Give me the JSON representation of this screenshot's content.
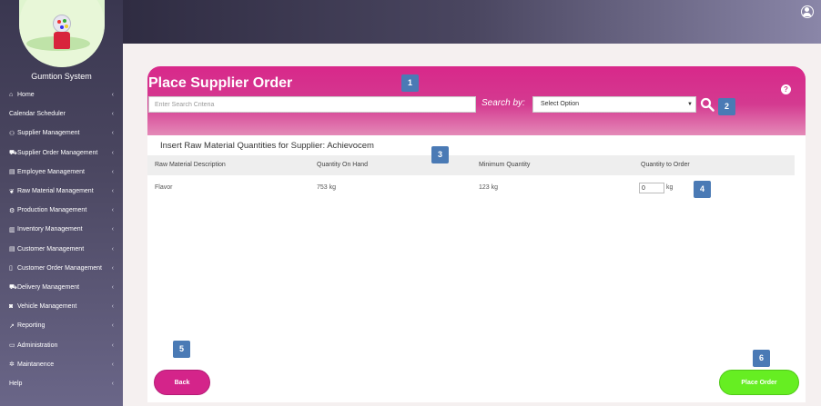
{
  "app": {
    "name": "Gumtion System"
  },
  "sidebar": {
    "items": [
      {
        "label": "Home",
        "icon": "home-icon",
        "glyph": "⌂",
        "chevron": "‹"
      },
      {
        "label": "Calendar Scheduler",
        "icon": "",
        "glyph": "",
        "chevron": "‹"
      },
      {
        "label": "Supplier Management",
        "icon": "users-icon",
        "glyph": "⚇",
        "chevron": "‹"
      },
      {
        "label": "Supplier Order Management",
        "icon": "cart-icon",
        "glyph": "⛟",
        "chevron": "‹"
      },
      {
        "label": "Employee Management",
        "icon": "id-card-icon",
        "glyph": "▤",
        "chevron": "‹"
      },
      {
        "label": "Raw Material Management",
        "icon": "leaf-icon",
        "glyph": "❦",
        "chevron": "‹"
      },
      {
        "label": "Production Management",
        "icon": "cogs-icon",
        "glyph": "⚙",
        "chevron": "‹"
      },
      {
        "label": "Inventory Management",
        "icon": "barcode-icon",
        "glyph": "▥",
        "chevron": "‹"
      },
      {
        "label": "Customer Management",
        "icon": "address-card-icon",
        "glyph": "▤",
        "chevron": "‹"
      },
      {
        "label": "Customer Order Management",
        "icon": "file-icon",
        "glyph": "▯",
        "chevron": "‹"
      },
      {
        "label": "Delivery Management",
        "icon": "truck-icon",
        "glyph": "⛟",
        "chevron": "‹"
      },
      {
        "label": "Vehicle Management",
        "icon": "car-icon",
        "glyph": "◙",
        "chevron": "‹"
      },
      {
        "label": "Reporting",
        "icon": "chart-icon",
        "glyph": "↗",
        "chevron": "‹"
      },
      {
        "label": "Administration",
        "icon": "laptop-icon",
        "glyph": "▭",
        "chevron": "‹"
      },
      {
        "label": "Maintanence",
        "icon": "gear-icon",
        "glyph": "✲",
        "chevron": "‹"
      },
      {
        "label": "Help",
        "icon": "",
        "glyph": "",
        "chevron": "‹"
      }
    ]
  },
  "header": {
    "title": "Place Supplier Order",
    "search_placeholder": "Enter Search Criteria",
    "search_by_label": "Search by:",
    "select_value": "Select Option",
    "help_glyph": "?"
  },
  "section": {
    "title": "Insert Raw Material Quantities for Supplier: Achievocem"
  },
  "table": {
    "columns": [
      "Raw Material Description",
      "Quantity On Hand",
      "Minimum Quantity",
      "Quantity to Order"
    ],
    "rows": [
      {
        "description": "Flavor",
        "on_hand": "753 kg",
        "minimum": "123 kg",
        "to_order": "0",
        "unit": "kg"
      }
    ]
  },
  "buttons": {
    "back": "Back",
    "place_order": "Place Order"
  },
  "badges": [
    "1",
    "2",
    "3",
    "4",
    "5",
    "6"
  ],
  "colors": {
    "accent_pink": "#d43a90",
    "accent_green": "#66ee22",
    "sidebar_bg": "#3a3750",
    "badge_blue": "#4a7ab5"
  }
}
